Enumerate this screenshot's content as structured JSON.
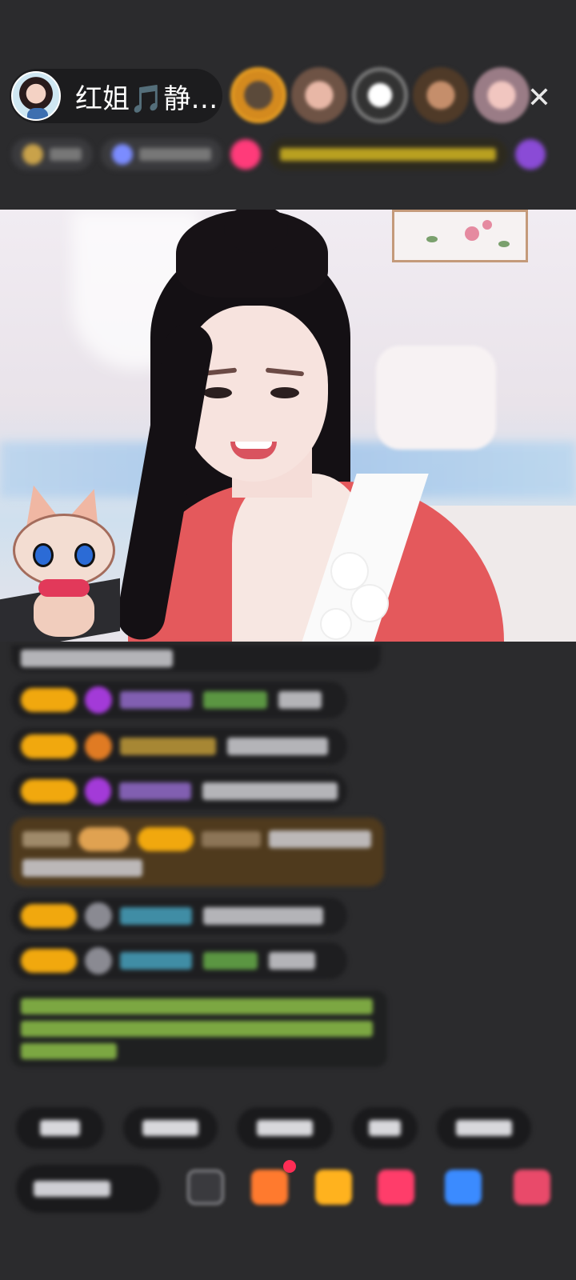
{
  "header": {
    "host_name": "红姐🎵静…",
    "close_label": "✕",
    "viewers": [
      "viewer-1",
      "viewer-2",
      "viewer-3",
      "viewer-4",
      "viewer-5"
    ]
  },
  "icons": {
    "close": "close-icon",
    "more": "more-icon"
  },
  "colors": {
    "background": "#2b2b2d",
    "level_badge": "#f1a80e",
    "special_message_bg": "#4f3a1d",
    "system_text": "#93c94b"
  }
}
